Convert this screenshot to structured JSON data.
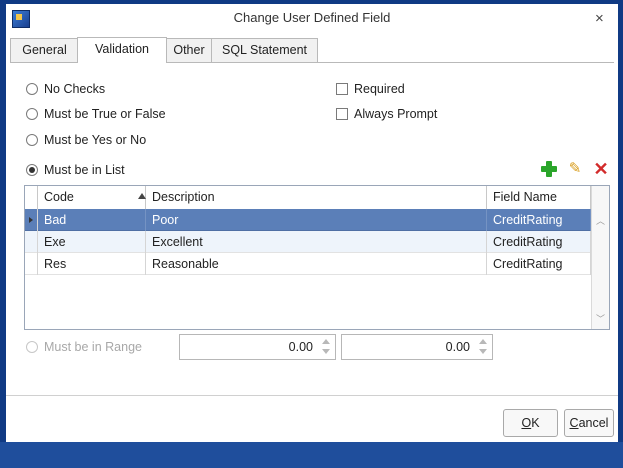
{
  "window": {
    "title": "Change User Defined Field",
    "close_glyph": "×",
    "icon": "app-icon"
  },
  "tabs": [
    {
      "label": "General",
      "active": false
    },
    {
      "label": "Validation",
      "active": true
    },
    {
      "label": "Other",
      "active": false
    },
    {
      "label": "SQL Statement",
      "active": false
    }
  ],
  "validation": {
    "options": [
      {
        "label": "No Checks",
        "checked": false,
        "enabled": true
      },
      {
        "label": "Must be True or False",
        "checked": false,
        "enabled": true
      },
      {
        "label": "Must be Yes or No",
        "checked": false,
        "enabled": true
      },
      {
        "label": "Must be in List",
        "checked": true,
        "enabled": true
      },
      {
        "label": "Must be in Range",
        "checked": false,
        "enabled": false
      }
    ],
    "checkboxes": [
      {
        "label": "Required",
        "checked": false
      },
      {
        "label": "Always Prompt",
        "checked": false
      }
    ],
    "list_tools": {
      "add_icon": "add-icon",
      "edit_icon": "pencil-icon",
      "delete_icon": "delete-icon"
    }
  },
  "grid": {
    "columns": [
      "Code",
      "Description",
      "Field Name"
    ],
    "sorted_column": "Code",
    "sort_direction": "ascending",
    "rows": [
      {
        "code": "Bad",
        "description": "Poor",
        "field_name": "CreditRating",
        "selected": true
      },
      {
        "code": "Exe",
        "description": "Excellent",
        "field_name": "CreditRating",
        "selected": false
      },
      {
        "code": "Res",
        "description": "Reasonable",
        "field_name": "CreditRating",
        "selected": false
      }
    ]
  },
  "range": {
    "min": "0.00",
    "max": "0.00"
  },
  "buttons": {
    "ok": "OK",
    "ok_mnemonic": "O",
    "ok_rest": "K",
    "cancel": "Cancel",
    "cancel_mnemonic": "C",
    "cancel_rest": "ancel"
  },
  "colors": {
    "frame": "#103a84",
    "selected_row": "#5b7fb8",
    "add": "#2aa52a",
    "delete": "#d22b2b",
    "edit": "#d89b18"
  }
}
